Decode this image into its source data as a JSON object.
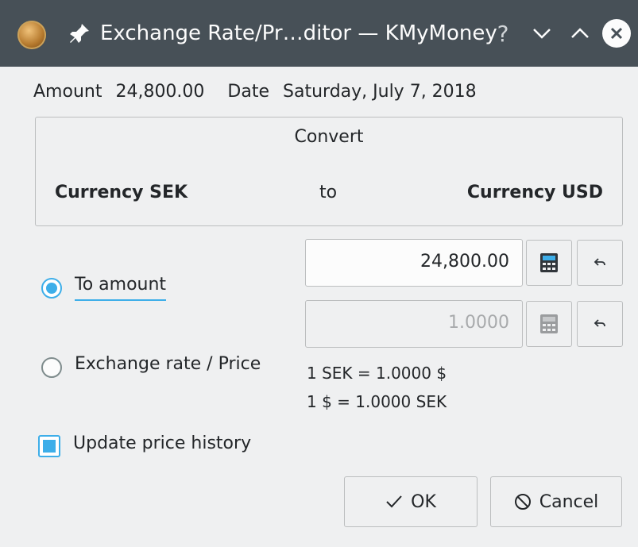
{
  "window": {
    "title": "Exchange Rate/Pr…ditor — KMyMoney",
    "help_glyph": "?"
  },
  "info": {
    "amount_label": "Amount",
    "amount_value": "24,800.00",
    "date_label": "Date",
    "date_value": "Saturday, July 7, 2018"
  },
  "convert": {
    "title": "Convert",
    "from_currency": "Currency SEK",
    "to_word": "to",
    "to_currency": "Currency USD"
  },
  "options": {
    "to_amount_label": "To amount",
    "to_amount_selected": true,
    "exchange_rate_label": "Exchange rate / Price",
    "exchange_rate_selected": false
  },
  "fields": {
    "amount_value": "24,800.00",
    "rate_value": "1.0000"
  },
  "rates": {
    "line1": "1 SEK = 1.0000 $",
    "line2": "1 $ = 1.0000 SEK"
  },
  "update_history": {
    "label": "Update price history",
    "checked": true
  },
  "buttons": {
    "ok_label": "OK",
    "cancel_label": "Cancel"
  },
  "colors": {
    "accent": "#3daee9",
    "titlebar": "#475057",
    "background": "#eff0f1"
  }
}
